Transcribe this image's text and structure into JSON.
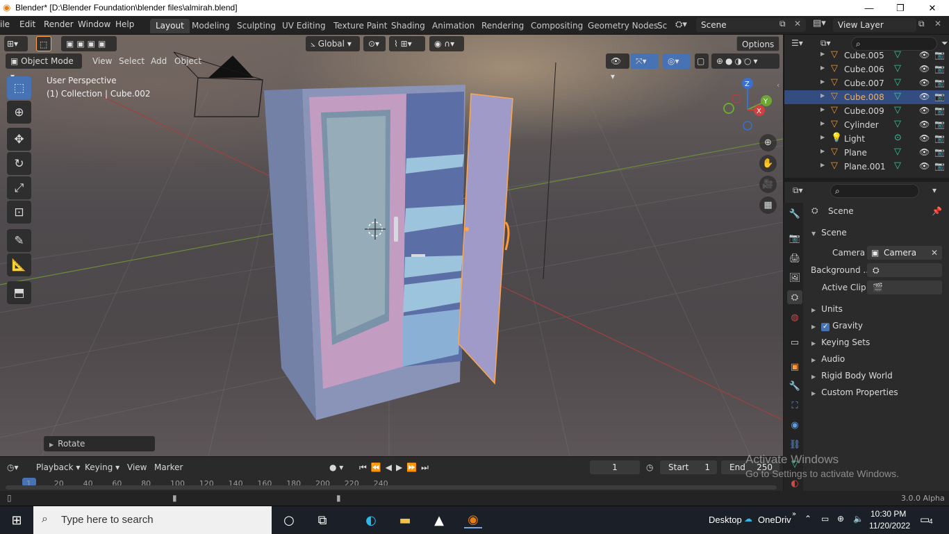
{
  "titlebar": {
    "title": "Blender* [D:\\Blender Foundation\\blender files\\almirah.blend]",
    "minimize": "—",
    "maximize": "❐",
    "close": "✕"
  },
  "menu": {
    "file": "ile",
    "edit": "Edit",
    "render": "Render",
    "window": "Window",
    "help": "Help"
  },
  "workspaces": [
    "Layout",
    "Modeling",
    "Sculpting",
    "UV Editing",
    "Texture Paint",
    "Shading",
    "Animation",
    "Rendering",
    "Compositing",
    "Geometry Nodes",
    "Sc"
  ],
  "scene_selector": "Scene",
  "view_layer": "View Layer",
  "header": {
    "orientation": "Global",
    "options": "Options"
  },
  "viewport_header": {
    "mode": "Object Mode",
    "view": "View",
    "select": "Select",
    "add": "Add",
    "object": "Object"
  },
  "viewport": {
    "perspective": "User Perspective",
    "collection_info": "(1) Collection | Cube.002",
    "operator_panel": "Rotate"
  },
  "gizmo": {
    "z": "Z",
    "y": "Y",
    "x": "X"
  },
  "outliner": {
    "items": [
      {
        "name": "Cube.005",
        "selected": false
      },
      {
        "name": "Cube.006",
        "selected": false
      },
      {
        "name": "Cube.007",
        "selected": false
      },
      {
        "name": "Cube.008",
        "selected": true
      },
      {
        "name": "Cube.009",
        "selected": false
      },
      {
        "name": "Cylinder",
        "selected": false
      },
      {
        "name": "Light",
        "selected": false
      },
      {
        "name": "Plane",
        "selected": false
      },
      {
        "name": "Plane.001",
        "selected": false
      }
    ]
  },
  "properties": {
    "breadcrumb": "Scene",
    "panel_title": "Scene",
    "camera_label": "Camera",
    "camera_value": "Camera",
    "background_label": "Background ...",
    "active_clip_label": "Active Clip",
    "sections": [
      "Units",
      "Gravity",
      "Keying Sets",
      "Audio",
      "Rigid Body World",
      "Custom Properties"
    ],
    "gravity_checked": true
  },
  "timeline": {
    "playback": "Playback",
    "keying": "Keying",
    "view": "View",
    "marker": "Marker",
    "current_frame": "1",
    "start_label": "Start",
    "start": "1",
    "end_label": "End",
    "end": "250",
    "ticks": [
      "1",
      "20",
      "40",
      "60",
      "80",
      "100",
      "120",
      "140",
      "160",
      "180",
      "200",
      "220",
      "240"
    ]
  },
  "status": {
    "version": "3.0.0 Alpha"
  },
  "watermark": {
    "line1": "Activate Windows",
    "line2": "Go to Settings to activate Windows."
  },
  "taskbar": {
    "search_placeholder": "Type here to search",
    "desktop": "Desktop",
    "onedrive": "OneDrive",
    "time": "10:30 PM",
    "date": "11/20/2022",
    "notifications": "4"
  }
}
